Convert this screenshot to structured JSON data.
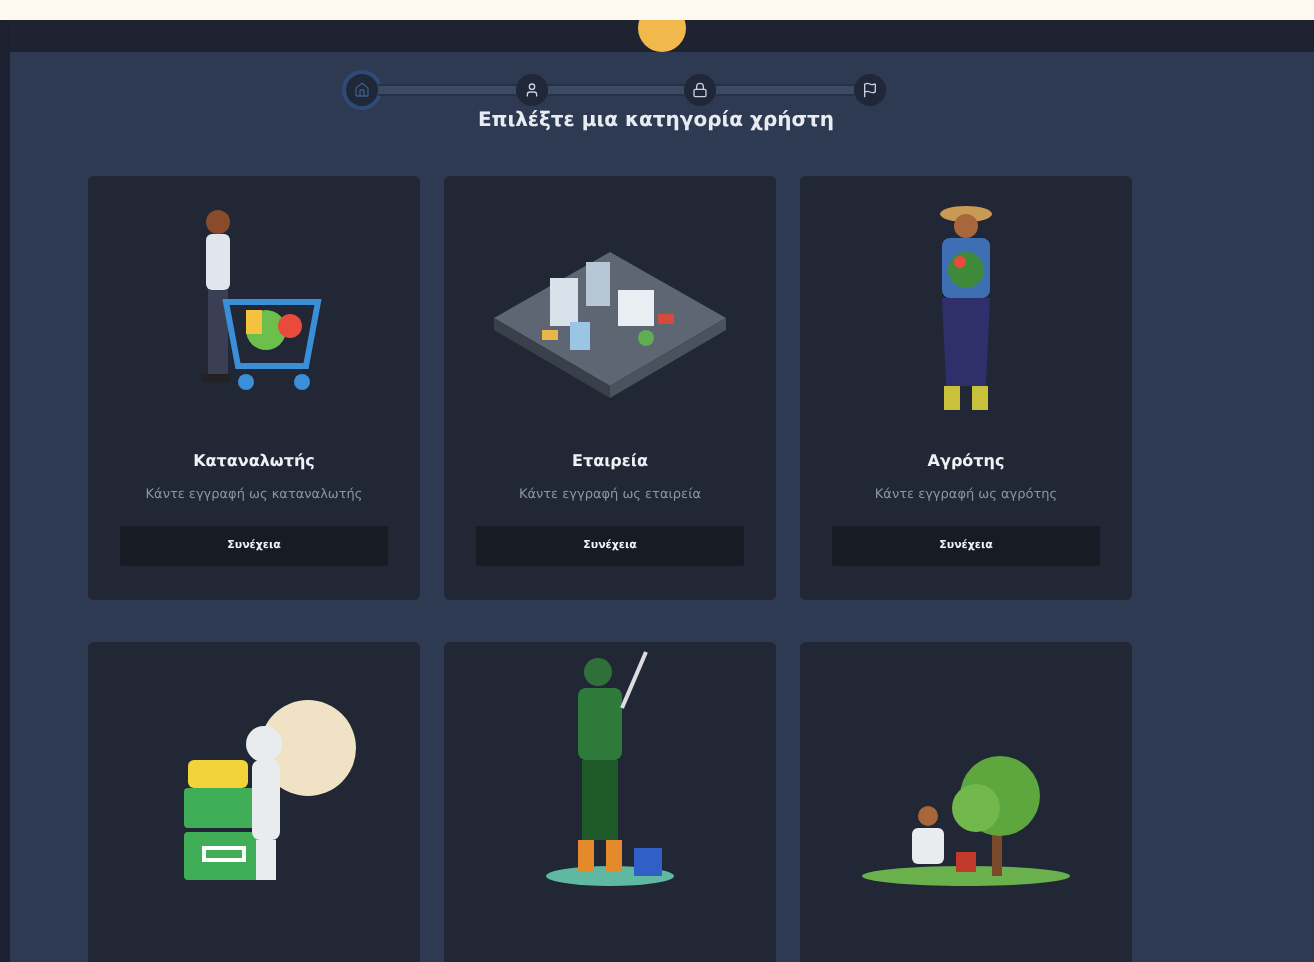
{
  "stepper": {
    "steps": [
      {
        "kind": "home",
        "selected": true
      },
      {
        "kind": "user",
        "selected": false
      },
      {
        "kind": "lock",
        "selected": false
      },
      {
        "kind": "flag",
        "selected": false
      }
    ],
    "title": "Επιλέξτε μια κατηγορία χρήστη"
  },
  "categories": [
    {
      "kind": "shopper",
      "title": "Καταναλωτής",
      "subtitle": "Κάντε εγγραφή ως καταναλωτής",
      "button": "Συνέχεια"
    },
    {
      "kind": "city",
      "title": "Εταιρεία",
      "subtitle": "Κάντε εγγραφή ως εταιρεία",
      "button": "Συνέχεια"
    },
    {
      "kind": "farmer",
      "title": "Αγρότης",
      "subtitle": "Κάντε εγγραφή ως αγρότης",
      "button": "Συνέχεια"
    },
    {
      "kind": "beekeeper"
    },
    {
      "kind": "fisher"
    },
    {
      "kind": "gardener"
    }
  ]
}
